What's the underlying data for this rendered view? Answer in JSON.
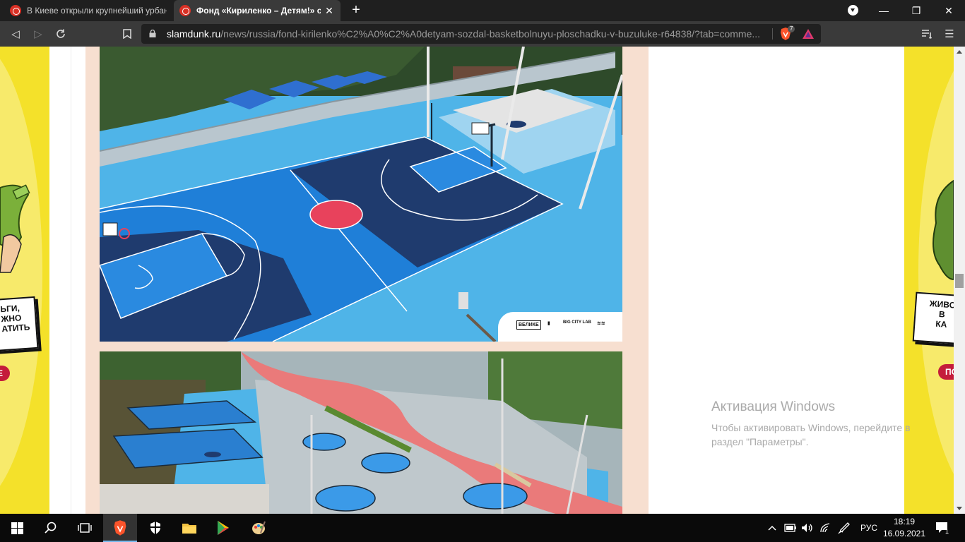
{
  "tabs": [
    {
      "title": "В Киеве открыли крупнейший урбан...",
      "active": false
    },
    {
      "title": "Фонд «Кириленко – Детям!» соз...",
      "active": true
    }
  ],
  "toolbar": {
    "url_host": "slamdunk.ru",
    "url_path": "/news/russia/fond-kirilenko%C2%A0%C2%A0detyam-sozdal-basketbolnuyu-ploschadku-v-buzuluke-r64838/?tab=comme...",
    "shields_count": "7"
  },
  "ads": {
    "left_text": [
      "ЬГИ,",
      "ЖНО",
      "АТИТЬ"
    ],
    "left_button": "Е",
    "right_text": [
      "ЖИВО",
      "В",
      "КА"
    ],
    "right_button": "ПО"
  },
  "photo_logos": [
    "ВЕЛИКЕ",
    "BIG CITY LAB"
  ],
  "activation": {
    "title": "Активация Windows",
    "line": "Чтобы активировать Windows, перейдите в раздел \"Параметры\"."
  },
  "tray": {
    "lang": "РУС",
    "time": "18:19",
    "date": "16.09.2021",
    "notifications": "1"
  },
  "icons": {
    "taskbar": [
      "windows-start-icon",
      "search-icon",
      "task-view-icon",
      "brave-browser-icon",
      "shield-app-icon",
      "file-explorer-icon",
      "play-store-icon",
      "paint-icon"
    ],
    "tray": [
      "chevron-up-icon",
      "battery-icon",
      "volume-icon",
      "wifi-icon",
      "pen-icon",
      "notification-icon"
    ]
  },
  "colors": {
    "ad_yellow": "#f4e12a",
    "ad_red": "#c41c3b",
    "court_light": "#33a9e6",
    "court_mid": "#1f7fd8",
    "court_dark": "#1f3b6e",
    "center_red": "#e8425c",
    "frame_peach": "#f7dfd0"
  }
}
